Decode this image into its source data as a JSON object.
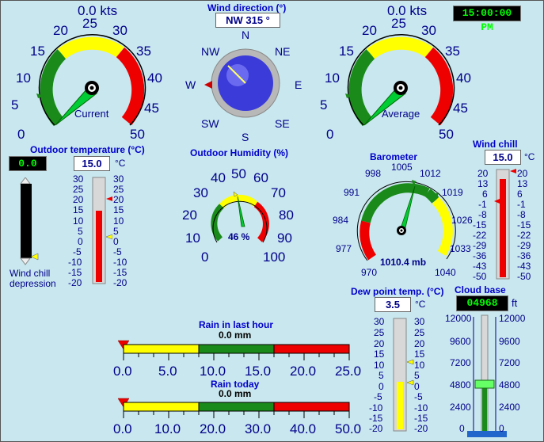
{
  "clock": "15:00:00 PM",
  "colors": {
    "green": "#1a8a1a",
    "yellow": "#ffff00",
    "red": "#ee0000",
    "blue": "#0000cc"
  },
  "wind_current": {
    "speed_text": "0.0 kts",
    "label": "Current",
    "ticks": [
      "0",
      "5",
      "10",
      "15",
      "20",
      "25",
      "30",
      "35",
      "40",
      "45",
      "50"
    ]
  },
  "wind_average": {
    "speed_text": "0.0 kts",
    "label": "Average",
    "ticks": [
      "0",
      "5",
      "10",
      "15",
      "20",
      "25",
      "30",
      "35",
      "40",
      "45",
      "50"
    ]
  },
  "wind_direction": {
    "title": "Wind direction (°)",
    "value": "NW 315 °",
    "points": [
      "N",
      "NE",
      "E",
      "SE",
      "S",
      "SW",
      "W",
      "NW"
    ],
    "degrees": 315
  },
  "outdoor_temp": {
    "title": "Outdoor temperature (°C)",
    "value": "15.0",
    "unit": "°C",
    "depression": "0.0",
    "depression_label_1": "Wind chill",
    "depression_label_2": "depression",
    "ticks": [
      "30",
      "25",
      "20",
      "15",
      "10",
      "5",
      "0",
      "-5",
      "-10",
      "-15",
      "-20"
    ],
    "level": 15
  },
  "humidity": {
    "title": "Outdoor Humidity (%)",
    "value_text": "46 %",
    "ticks": [
      "0",
      "10",
      "20",
      "30",
      "40",
      "50",
      "60",
      "70",
      "80",
      "90",
      "100"
    ],
    "level": 46
  },
  "barometer": {
    "title": "Barometer",
    "value_text": "1010.4 mb",
    "ticks": [
      "970",
      "977",
      "984",
      "991",
      "998",
      "1005",
      "1012",
      "1019",
      "1026",
      "1033",
      "1040"
    ],
    "level": 1010.4
  },
  "wind_chill": {
    "title": "Wind chill",
    "value": "15.0",
    "unit": "°C",
    "ticks": [
      "20",
      "13",
      "6",
      "-1",
      "-8",
      "-15",
      "-22",
      "-29",
      "-36",
      "-43",
      "-50"
    ],
    "level": 15
  },
  "dew_point": {
    "title": "Dew point temp. (°C)",
    "value": "3.5",
    "unit": "°C",
    "ticks": [
      "30",
      "25",
      "20",
      "15",
      "10",
      "5",
      "0",
      "-5",
      "-10",
      "-15",
      "-20"
    ],
    "level": 3.5
  },
  "cloud_base": {
    "title": "Cloud base",
    "value": "04968",
    "unit": "ft",
    "ticks": [
      "12000",
      "9600",
      "7200",
      "4800",
      "2400",
      "0"
    ],
    "level": 4968
  },
  "rain_hour": {
    "title": "Rain in last hour",
    "value_text": "0.0 mm",
    "ticks": [
      "0.0",
      "5.0",
      "10.0",
      "15.0",
      "20.0",
      "25.0"
    ]
  },
  "rain_today": {
    "title": "Rain today",
    "value_text": "0.0 mm",
    "ticks": [
      "0.0",
      "10.0",
      "20.0",
      "30.0",
      "40.0",
      "50.0"
    ]
  }
}
